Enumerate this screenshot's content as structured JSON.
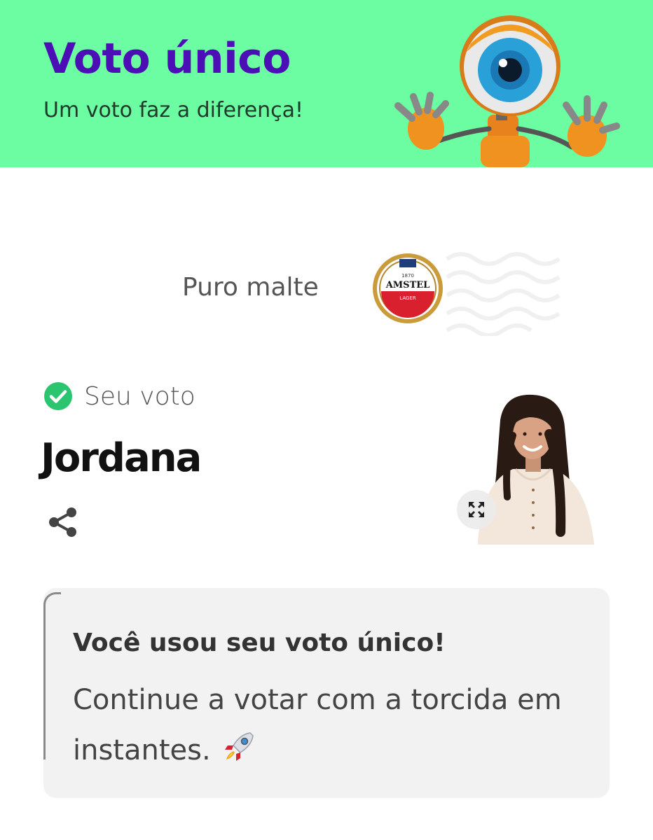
{
  "header": {
    "title": "Voto único",
    "subtitle": "Um voto faz a diferença!",
    "mascot": "big-brother-eye-mascot",
    "background_color": "#6cfca1",
    "title_color": "#4b0fb5"
  },
  "sponsor": {
    "text": "Puro malte",
    "logo": {
      "top_text": "1870",
      "brand": "AMSTEL",
      "sub": "LAGER"
    }
  },
  "vote": {
    "status_label": "Seu voto",
    "status_icon": "check-circle-icon",
    "status_color": "#2cc56f",
    "candidate_name": "Jordana",
    "share_icon": "share-icon",
    "expand_icon": "expand-icon"
  },
  "notice": {
    "title": "Você usou seu voto único!",
    "body": "Continue a votar com a torcida em instantes.",
    "icon": "rocket-icon"
  }
}
